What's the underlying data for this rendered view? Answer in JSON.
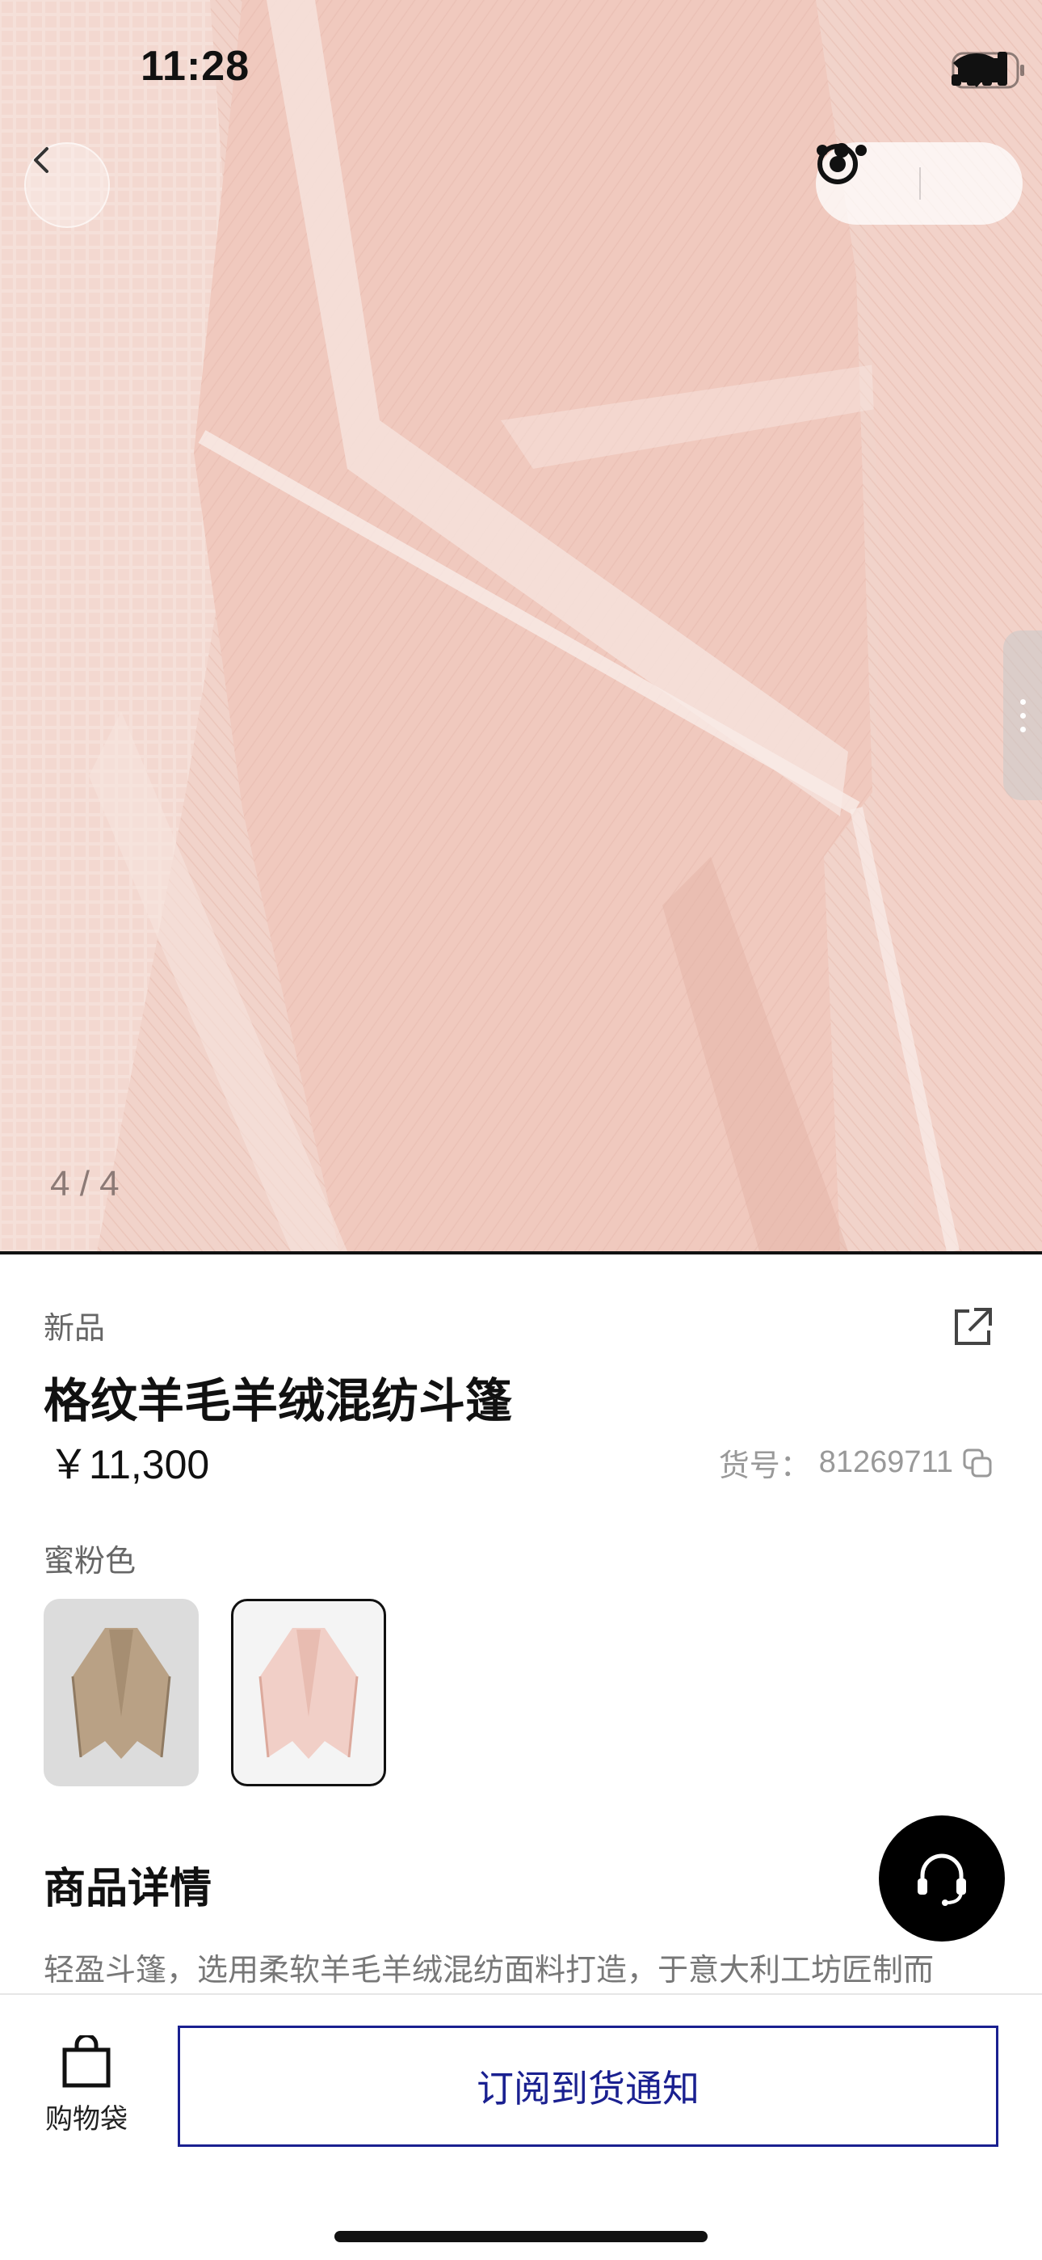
{
  "status_bar": {
    "time": "11:28",
    "icons": [
      "signal-icon",
      "wifi-icon",
      "battery-icon"
    ]
  },
  "nav": {
    "back_icon": "chevron-left-icon",
    "capsule_icons": [
      "more-dots-icon",
      "target-icon"
    ]
  },
  "gallery": {
    "page_indicator": "4 / 4"
  },
  "product": {
    "badge": "新品",
    "title": "格纹羊毛羊绒混纺斗篷",
    "price": "￥11,300",
    "sku_label": "货号：",
    "sku_value": "81269711",
    "color_label": "蜜粉色",
    "swatches": [
      {
        "name": "beige-cape",
        "color": "#c8b49a"
      },
      {
        "name": "pink-cape",
        "color": "#f1cfc7",
        "selected": true
      }
    ]
  },
  "details": {
    "heading": "商品详情",
    "text": "轻盈斗篷，选用柔软羊毛羊绒混纺面料打造，于意大利工坊匠制而"
  },
  "bottom_bar": {
    "bag_label": "购物袋",
    "notify_label": "订阅到货通知"
  },
  "colors": {
    "accent": "#1a2090",
    "fabric": "#f0cdc4"
  }
}
